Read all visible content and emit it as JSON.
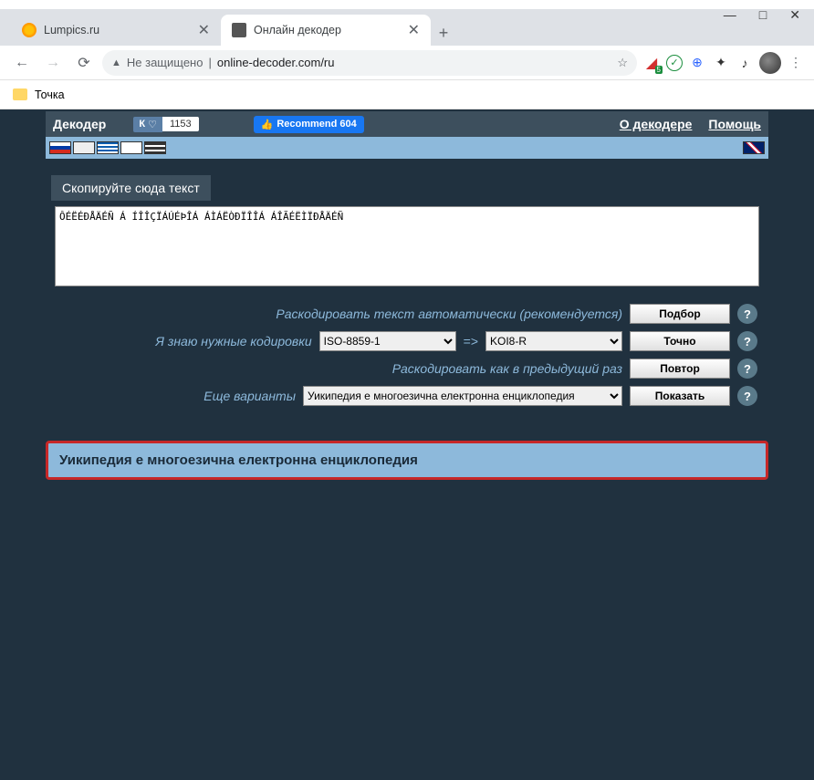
{
  "window": {
    "minimize": "—",
    "maximize": "□",
    "close": "✕"
  },
  "tabs": [
    {
      "title": "Lumpics.ru"
    },
    {
      "title": "Онлайн декодер"
    }
  ],
  "tab_close": "✕",
  "new_tab": "+",
  "nav": {
    "back": "←",
    "forward": "→",
    "reload": "⟳"
  },
  "address": {
    "warn_icon": "▲",
    "security": "Не защищено",
    "sep": "|",
    "url": "online-decoder.com/ru",
    "star": "☆"
  },
  "ext_icons": {
    "badge": "5",
    "check": "✓",
    "globe": "⊕",
    "puzzle": "✦",
    "music": "♪",
    "menu": "⋮"
  },
  "bookmarks": {
    "item": "Точка"
  },
  "app": {
    "title": "Декодер",
    "vk_label": "К",
    "vk_heart": "♡",
    "vk_count": "1153",
    "fb_thumb": "👍",
    "fb_label": "Recommend 604",
    "link_about": "О декодере",
    "link_help": "Помощь"
  },
  "section_label": "Скопируйте сюда текст",
  "textarea_value": "ÔÉËÉÐÅÄÉÑ Á ÍÎÎÇÏÁÚÉÞÎÁ ÁÌÁËÒÐÏÎÎÁ ÁÎÃÉËÌÏÐÅÄÉÑ",
  "options": {
    "auto_label": "Раскодировать текст автоматически (рекомендуется)",
    "auto_btn": "Подбор",
    "know_label": "Я знаю нужные кодировки",
    "enc_from": "ISO-8859-1",
    "arrow": "=>",
    "enc_to": "KOI8-R",
    "exact_btn": "Точно",
    "prev_label": "Раскодировать как в предыдущий раз",
    "prev_btn": "Повтор",
    "more_label": "Еще варианты",
    "more_select": "Уикипедия е многоезична електронна енциклопедия",
    "show_btn": "Показать",
    "help": "?"
  },
  "result_text": "Уикипедия е многоезична електронна енциклопедия"
}
